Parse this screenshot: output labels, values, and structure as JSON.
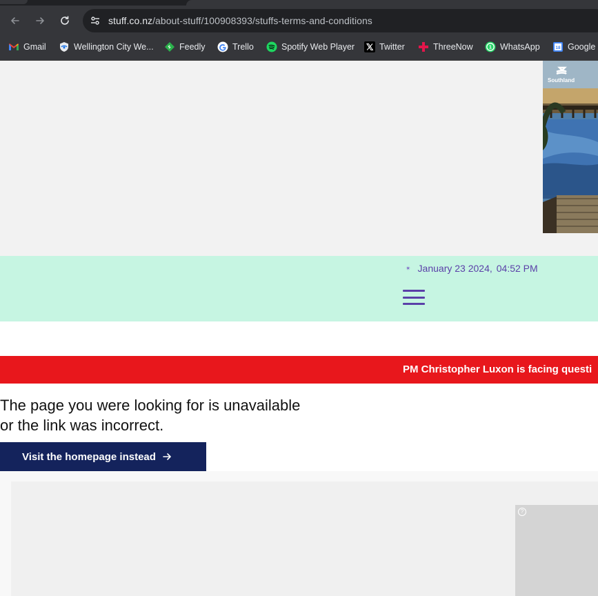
{
  "browser": {
    "url_host": "stuff.co.nz",
    "url_path": "/about-stuff/100908393/stuffs-terms-and-conditions"
  },
  "bookmarks": [
    {
      "label": "Gmail",
      "icon": "gmail-icon"
    },
    {
      "label": "Wellington City We...",
      "icon": "wellington-icon"
    },
    {
      "label": "Feedly",
      "icon": "feedly-icon"
    },
    {
      "label": "Trello",
      "icon": "google-icon"
    },
    {
      "label": "Spotify Web Player",
      "icon": "spotify-icon"
    },
    {
      "label": "Twitter",
      "icon": "x-icon"
    },
    {
      "label": "ThreeNow",
      "icon": "threenow-icon"
    },
    {
      "label": "WhatsApp",
      "icon": "whatsapp-icon"
    },
    {
      "label": "Google C",
      "icon": "google-calendar-icon"
    }
  ],
  "ad_top": {
    "brand": "Southland"
  },
  "header": {
    "date": "January 23 2024,",
    "time": "04:52 PM"
  },
  "ticker": {
    "text": "PM Christopher Luxon is facing questi"
  },
  "error": {
    "line1": "The page you were looking for is unavailable",
    "line2": "or the link was incorrect.",
    "button_label": "Visit the homepage instead"
  },
  "ad_bottom": {
    "info_glyph": "?"
  },
  "colors": {
    "header_band": "#c6f5e2",
    "accent_purple": "#5a3fa8",
    "ticker_red": "#e8171c",
    "button_navy": "#14235c"
  }
}
